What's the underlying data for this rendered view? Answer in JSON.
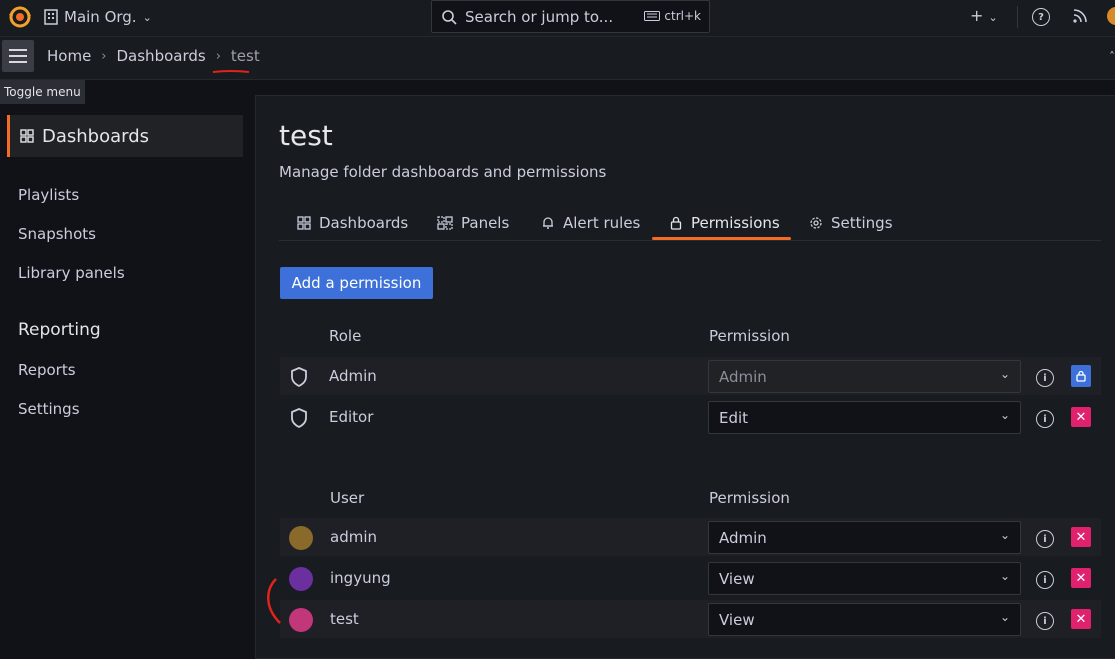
{
  "topbar": {
    "org_name": "Main Org.",
    "search_placeholder": "Search or jump to...",
    "search_shortcut": "ctrl+k",
    "icons": [
      "grafana-logo-icon",
      "org-icon",
      "search-icon",
      "keyboard-icon",
      "plus-icon",
      "help-icon",
      "rss-icon",
      "avatar"
    ]
  },
  "breadcrumb": {
    "items": [
      "Home",
      "Dashboards",
      "test"
    ],
    "toggle_tooltip": "Toggle menu"
  },
  "sidebar": {
    "active_label": "Dashboards",
    "items": [
      "Playlists",
      "Snapshots",
      "Library panels"
    ],
    "section_title": "Reporting",
    "section_items": [
      "Reports",
      "Settings"
    ]
  },
  "page": {
    "title": "test",
    "subtitle": "Manage folder dashboards and permissions",
    "tabs": [
      {
        "label": "Dashboards",
        "icon": "grid-icon"
      },
      {
        "label": "Panels",
        "icon": "panels-icon"
      },
      {
        "label": "Alert rules",
        "icon": "bell-icon"
      },
      {
        "label": "Permissions",
        "icon": "lock-icon",
        "active": true
      },
      {
        "label": "Settings",
        "icon": "gear-icon"
      }
    ],
    "add_button": "Add a permission"
  },
  "roles": {
    "header_role": "Role",
    "header_permission": "Permission",
    "rows": [
      {
        "name": "Admin",
        "permission": "Admin",
        "locked": true
      },
      {
        "name": "Editor",
        "permission": "Edit",
        "locked": false
      }
    ]
  },
  "users": {
    "header_user": "User",
    "header_permission": "Permission",
    "rows": [
      {
        "name": "admin",
        "permission": "Admin",
        "avatar_color": "#8a6a2a"
      },
      {
        "name": "ingyung",
        "permission": "View",
        "avatar_color": "#6b2fa0"
      },
      {
        "name": "test",
        "permission": "View",
        "avatar_color": "#c2377a"
      }
    ]
  },
  "colors": {
    "accent": "#f46b26",
    "primary": "#3d71d9",
    "danger": "#e0226e",
    "annotation": "#e0241b"
  }
}
